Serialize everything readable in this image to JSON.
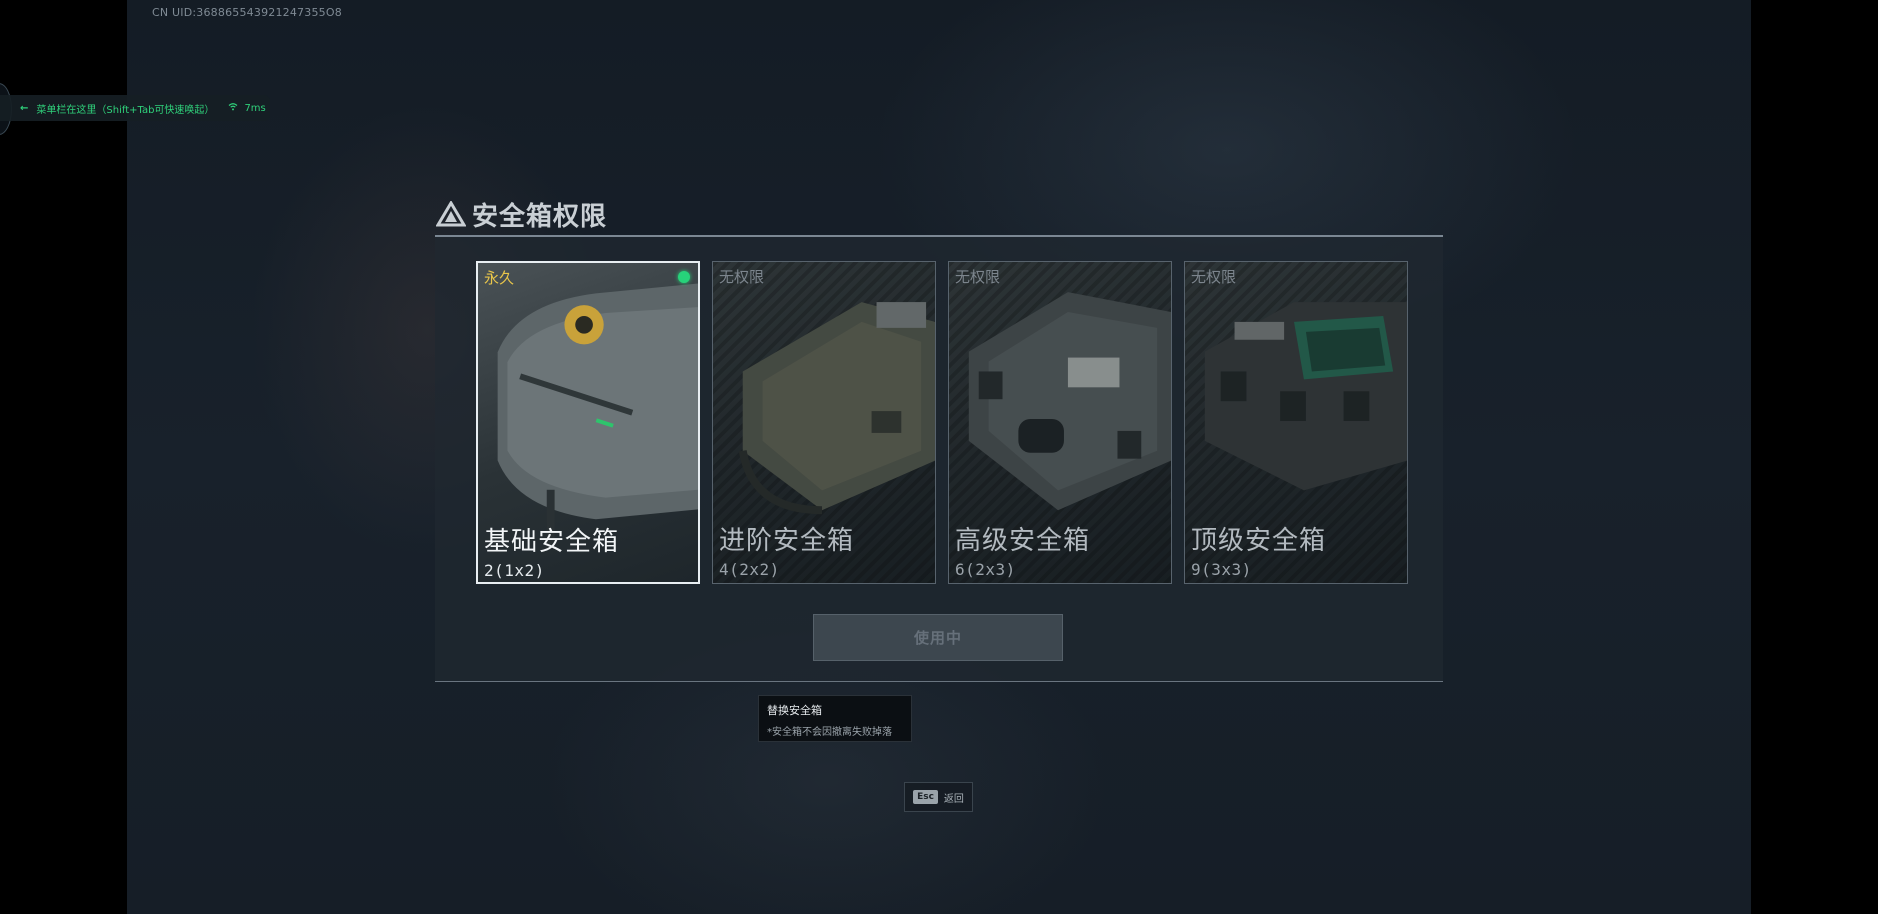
{
  "uid_text": "CN UID:368865543921247355O8",
  "menu_hint": {
    "text": "菜单栏在这里（Shift+Tab可快速唤起）",
    "ping": "7ms",
    "arrow_icon": "arrow-left-icon",
    "signal_icon": "wifi-icon"
  },
  "dialog": {
    "title": "安全箱权限",
    "title_icon": "warning-triangle-icon"
  },
  "cards": [
    {
      "status": "永久",
      "name": "基础安全箱",
      "size": "2(1x2)",
      "selected": true,
      "indicator_color": "#27d27a"
    },
    {
      "status": "无权限",
      "name": "进阶安全箱",
      "size": "4(2x2)",
      "selected": false
    },
    {
      "status": "无权限",
      "name": "高级安全箱",
      "size": "6(2x3)",
      "selected": false
    },
    {
      "status": "无权限",
      "name": "顶级安全箱",
      "size": "9(3x3)",
      "selected": false
    }
  ],
  "use_button": "使用中",
  "tooltip": {
    "title": "替换安全箱",
    "note": "*安全箱不会因撤离失败掉落"
  },
  "footer": {
    "key": "Esc",
    "label": "返回"
  },
  "colors": {
    "accent_green": "#27d27a",
    "permanent_yellow": "#e9c64a"
  }
}
